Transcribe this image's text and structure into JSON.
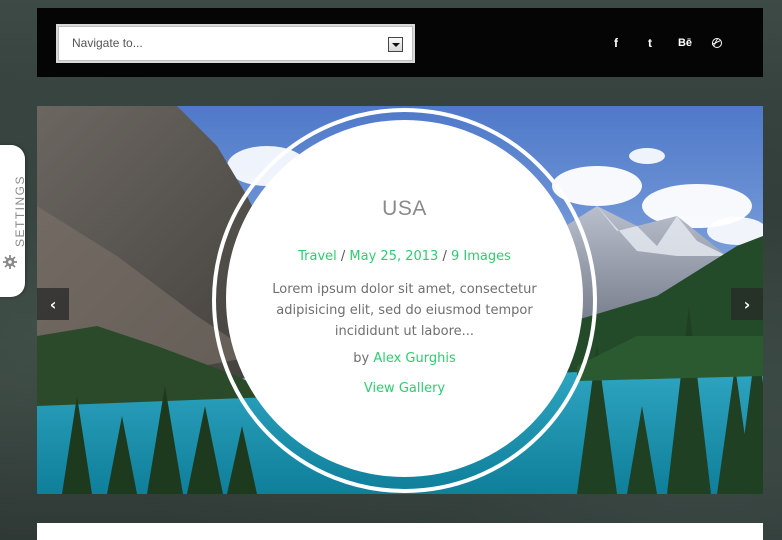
{
  "header": {
    "nav_select": {
      "placeholder": "Navigate to..."
    },
    "social": {
      "facebook": "f",
      "twitter": "t",
      "behance": "Bē",
      "dribbble_icon": "dribbble-icon"
    }
  },
  "settings": {
    "label": "SETTINGS",
    "icon": "gear-icon"
  },
  "slider": {
    "prev_icon": "‹",
    "next_icon": "›",
    "card": {
      "title": "USA",
      "category": "Travel",
      "sep1": " / ",
      "date": "May 25, 2013",
      "sep2": " / ",
      "images": "9 Images",
      "excerpt": "Lorem ipsum dolor sit amet, consectetur adipisicing elit, sed do eiusmod tempor incididunt ut labore...",
      "by_prefix": "by ",
      "author": "Alex Gurghis",
      "gallery_link": "View Gallery"
    }
  },
  "colors": {
    "accent": "#2ecc71",
    "header_bg": "#050505",
    "page_bg": "#34403b"
  }
}
